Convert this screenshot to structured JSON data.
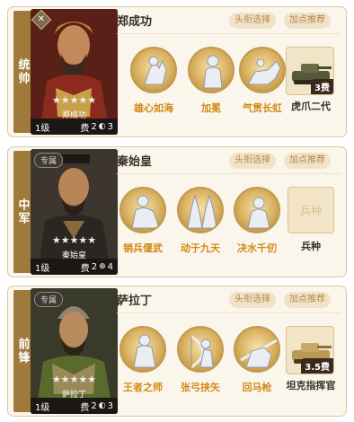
{
  "cards": [
    {
      "side_label": "统帅",
      "hero_name": "郑成功",
      "portrait_tag": "",
      "portrait_name": "郑成功",
      "stars": "★★★★★",
      "level": "1级",
      "cost_label": "费",
      "cost_value": "2",
      "troop_count": "3",
      "btn_skill": "头衔选择",
      "btn_points": "加点推荐",
      "skills": [
        "雄心如海",
        "加冕",
        "气贯长虹"
      ],
      "equip_label": "虎爪二代",
      "equip_fee": "3费"
    },
    {
      "side_label": "中军",
      "hero_name": "秦始皇",
      "portrait_tag": "专属",
      "portrait_name": "秦始皇",
      "stars": "★★★★★",
      "level": "1级",
      "cost_label": "费",
      "cost_value": "2",
      "troop_count": "4",
      "btn_skill": "头衔选择",
      "btn_points": "加点推荐",
      "skills": [
        "销兵偃武",
        "动于九天",
        "决水千仞"
      ],
      "equip_label": "兵种",
      "equip_placeholder": "兵种"
    },
    {
      "side_label": "前锋",
      "hero_name": "萨拉丁",
      "portrait_tag": "专属",
      "portrait_name": "萨拉丁",
      "stars": "★★★★★",
      "level": "1级",
      "cost_label": "费",
      "cost_value": "2",
      "troop_count": "3",
      "btn_skill": "头衔选择",
      "btn_points": "加点推荐",
      "skills": [
        "王者之师",
        "张弓挟矢",
        "回马枪"
      ],
      "equip_label": "坦克指挥官",
      "equip_fee": "3.5费"
    }
  ],
  "colors": {
    "accent": "#d28a18",
    "side": "#a07a3a",
    "card_bg": "#fbf6ec"
  }
}
